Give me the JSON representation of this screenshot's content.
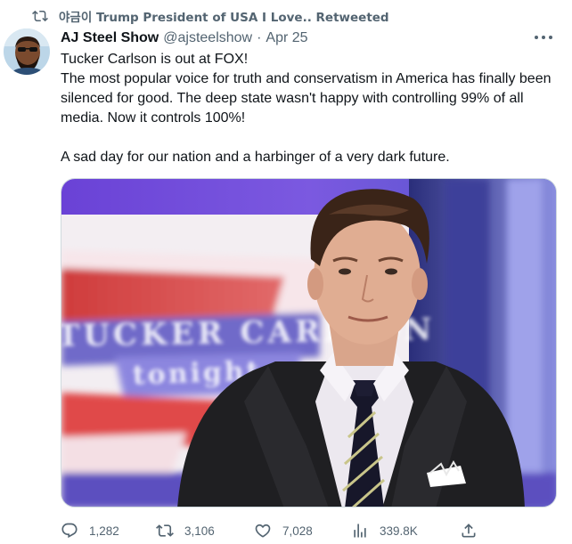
{
  "social_context": {
    "text": "야금이 Trump President of USA I Love.. Retweeted",
    "icon": "retweet-icon"
  },
  "author": {
    "display_name": "AJ Steel Show",
    "handle": "@ajsteelshow",
    "separator": "·",
    "date": "Apr 25"
  },
  "tweet": {
    "text": "Tucker Carlson is out at FOX!\nThe most popular voice for truth and conservatism in America has finally been silenced for good. The deep state wasn't happy with controlling 99% of all media. Now it controls 100%!\n\nA sad day for our nation and a harbinger of a very dark future."
  },
  "media": {
    "background_text": "TUCKER CARLSON",
    "background_subtext": "tonight"
  },
  "actions": {
    "replies": "1,282",
    "retweets": "3,106",
    "likes": "7,028",
    "views": "339.8K"
  },
  "colors": {
    "text_primary": "#0f1419",
    "text_secondary": "#536471",
    "border": "#cfd9de"
  }
}
